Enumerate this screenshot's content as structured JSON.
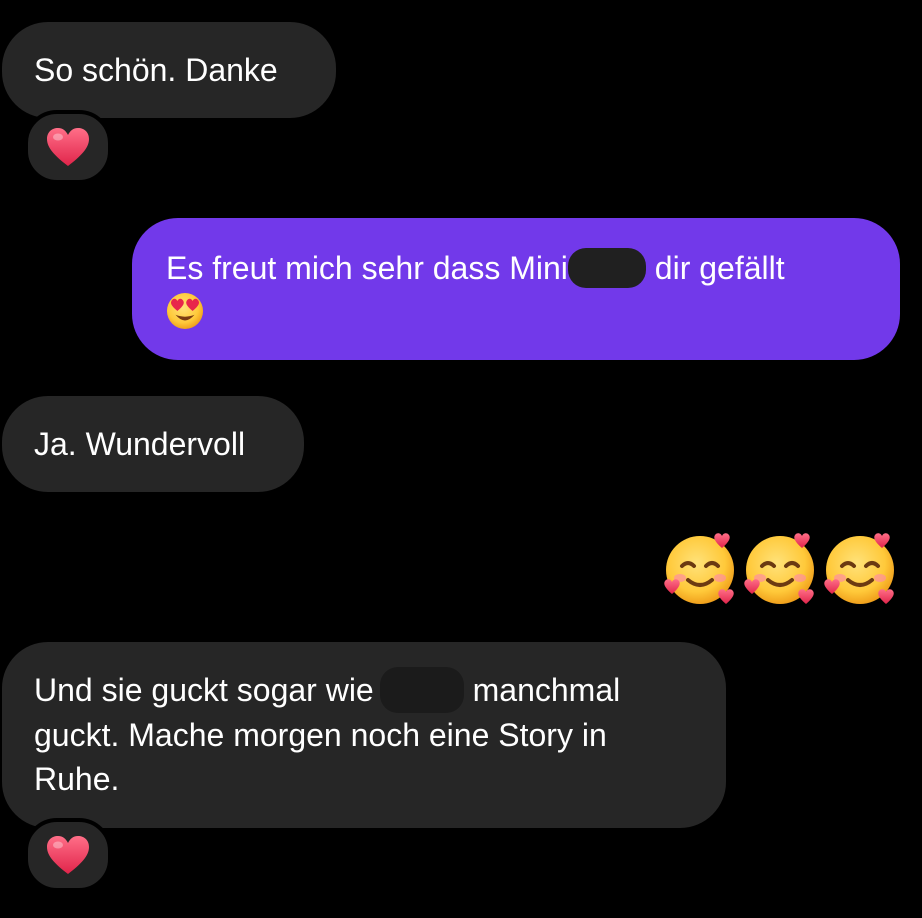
{
  "messages": [
    {
      "direction": "incoming",
      "text": "So schön. Danke",
      "reaction": "red-heart"
    },
    {
      "direction": "outgoing",
      "text_before_redaction": "Es freut mich sehr dass Mini",
      "redacted": true,
      "text_after_redaction": " dir gefällt",
      "trailing_emoji": "heart-eyes-face"
    },
    {
      "direction": "incoming",
      "text": "Ja. Wundervoll"
    },
    {
      "direction": "outgoing",
      "emoji_only": [
        "smiling-face-with-hearts",
        "smiling-face-with-hearts",
        "smiling-face-with-hearts"
      ]
    },
    {
      "direction": "incoming",
      "line1_before_redaction": "Und sie guckt sogar wie",
      "redacted": true,
      "line1_after_redaction": " manchmal",
      "line2": "guckt. Mache morgen noch eine Story in",
      "line3": "Ruhe.",
      "reaction": "red-heart"
    }
  ],
  "colors": {
    "background": "#000000",
    "incoming_bubble": "#262626",
    "outgoing_bubble": "#7239ea",
    "text": "#ffffff",
    "redaction_incoming": "#1b1b1b",
    "redaction_outgoing": "#202020"
  }
}
